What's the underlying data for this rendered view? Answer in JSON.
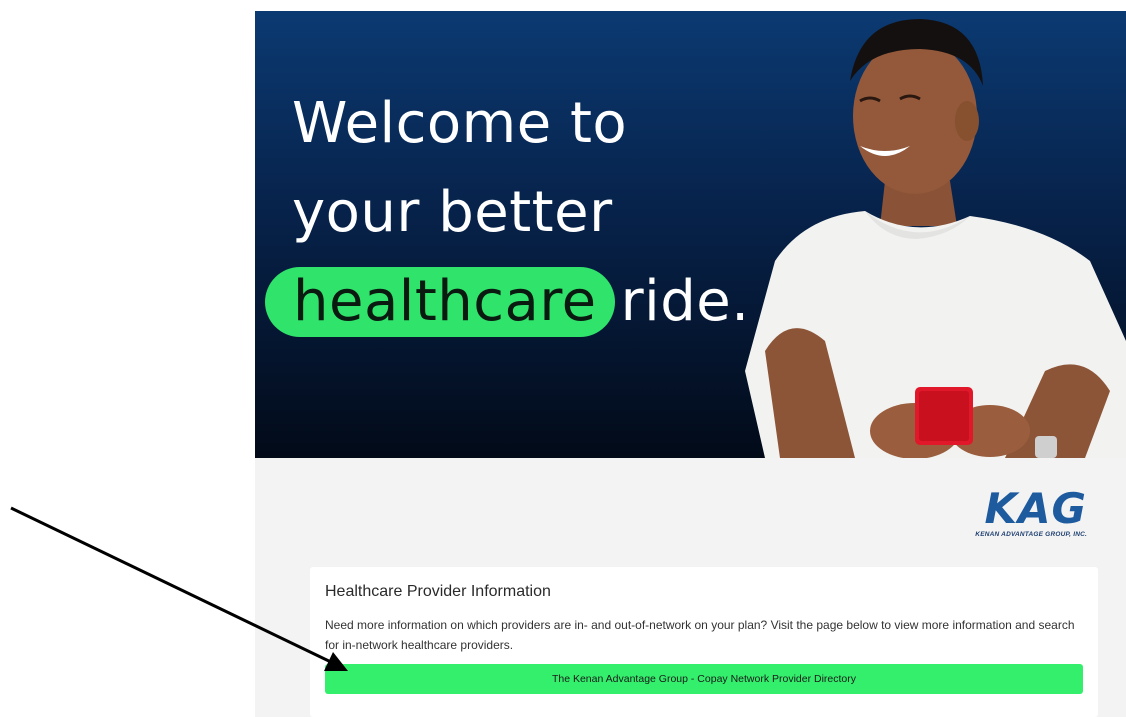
{
  "hero": {
    "line1": "Welcome to",
    "line2": "your better",
    "highlight": "healthcare",
    "line3_rest": "ride.",
    "highlight_color": "#2fe36b",
    "background_color": "#07224a"
  },
  "logo": {
    "main": "KAG",
    "sub": "KENAN ADVANTAGE GROUP, INC.",
    "color": "#1e5a9e"
  },
  "card": {
    "title": "Healthcare Provider Information",
    "body": "Need more information on which providers are in- and out-of-network on your plan? Visit the page below to view more information and search for in-network healthcare providers.",
    "button_label": "The Kenan Advantage Group - Copay Network Provider Directory",
    "button_color": "#33ef6c"
  },
  "annotation": {
    "icon": "pointer-arrow-icon",
    "color": "#000000"
  }
}
